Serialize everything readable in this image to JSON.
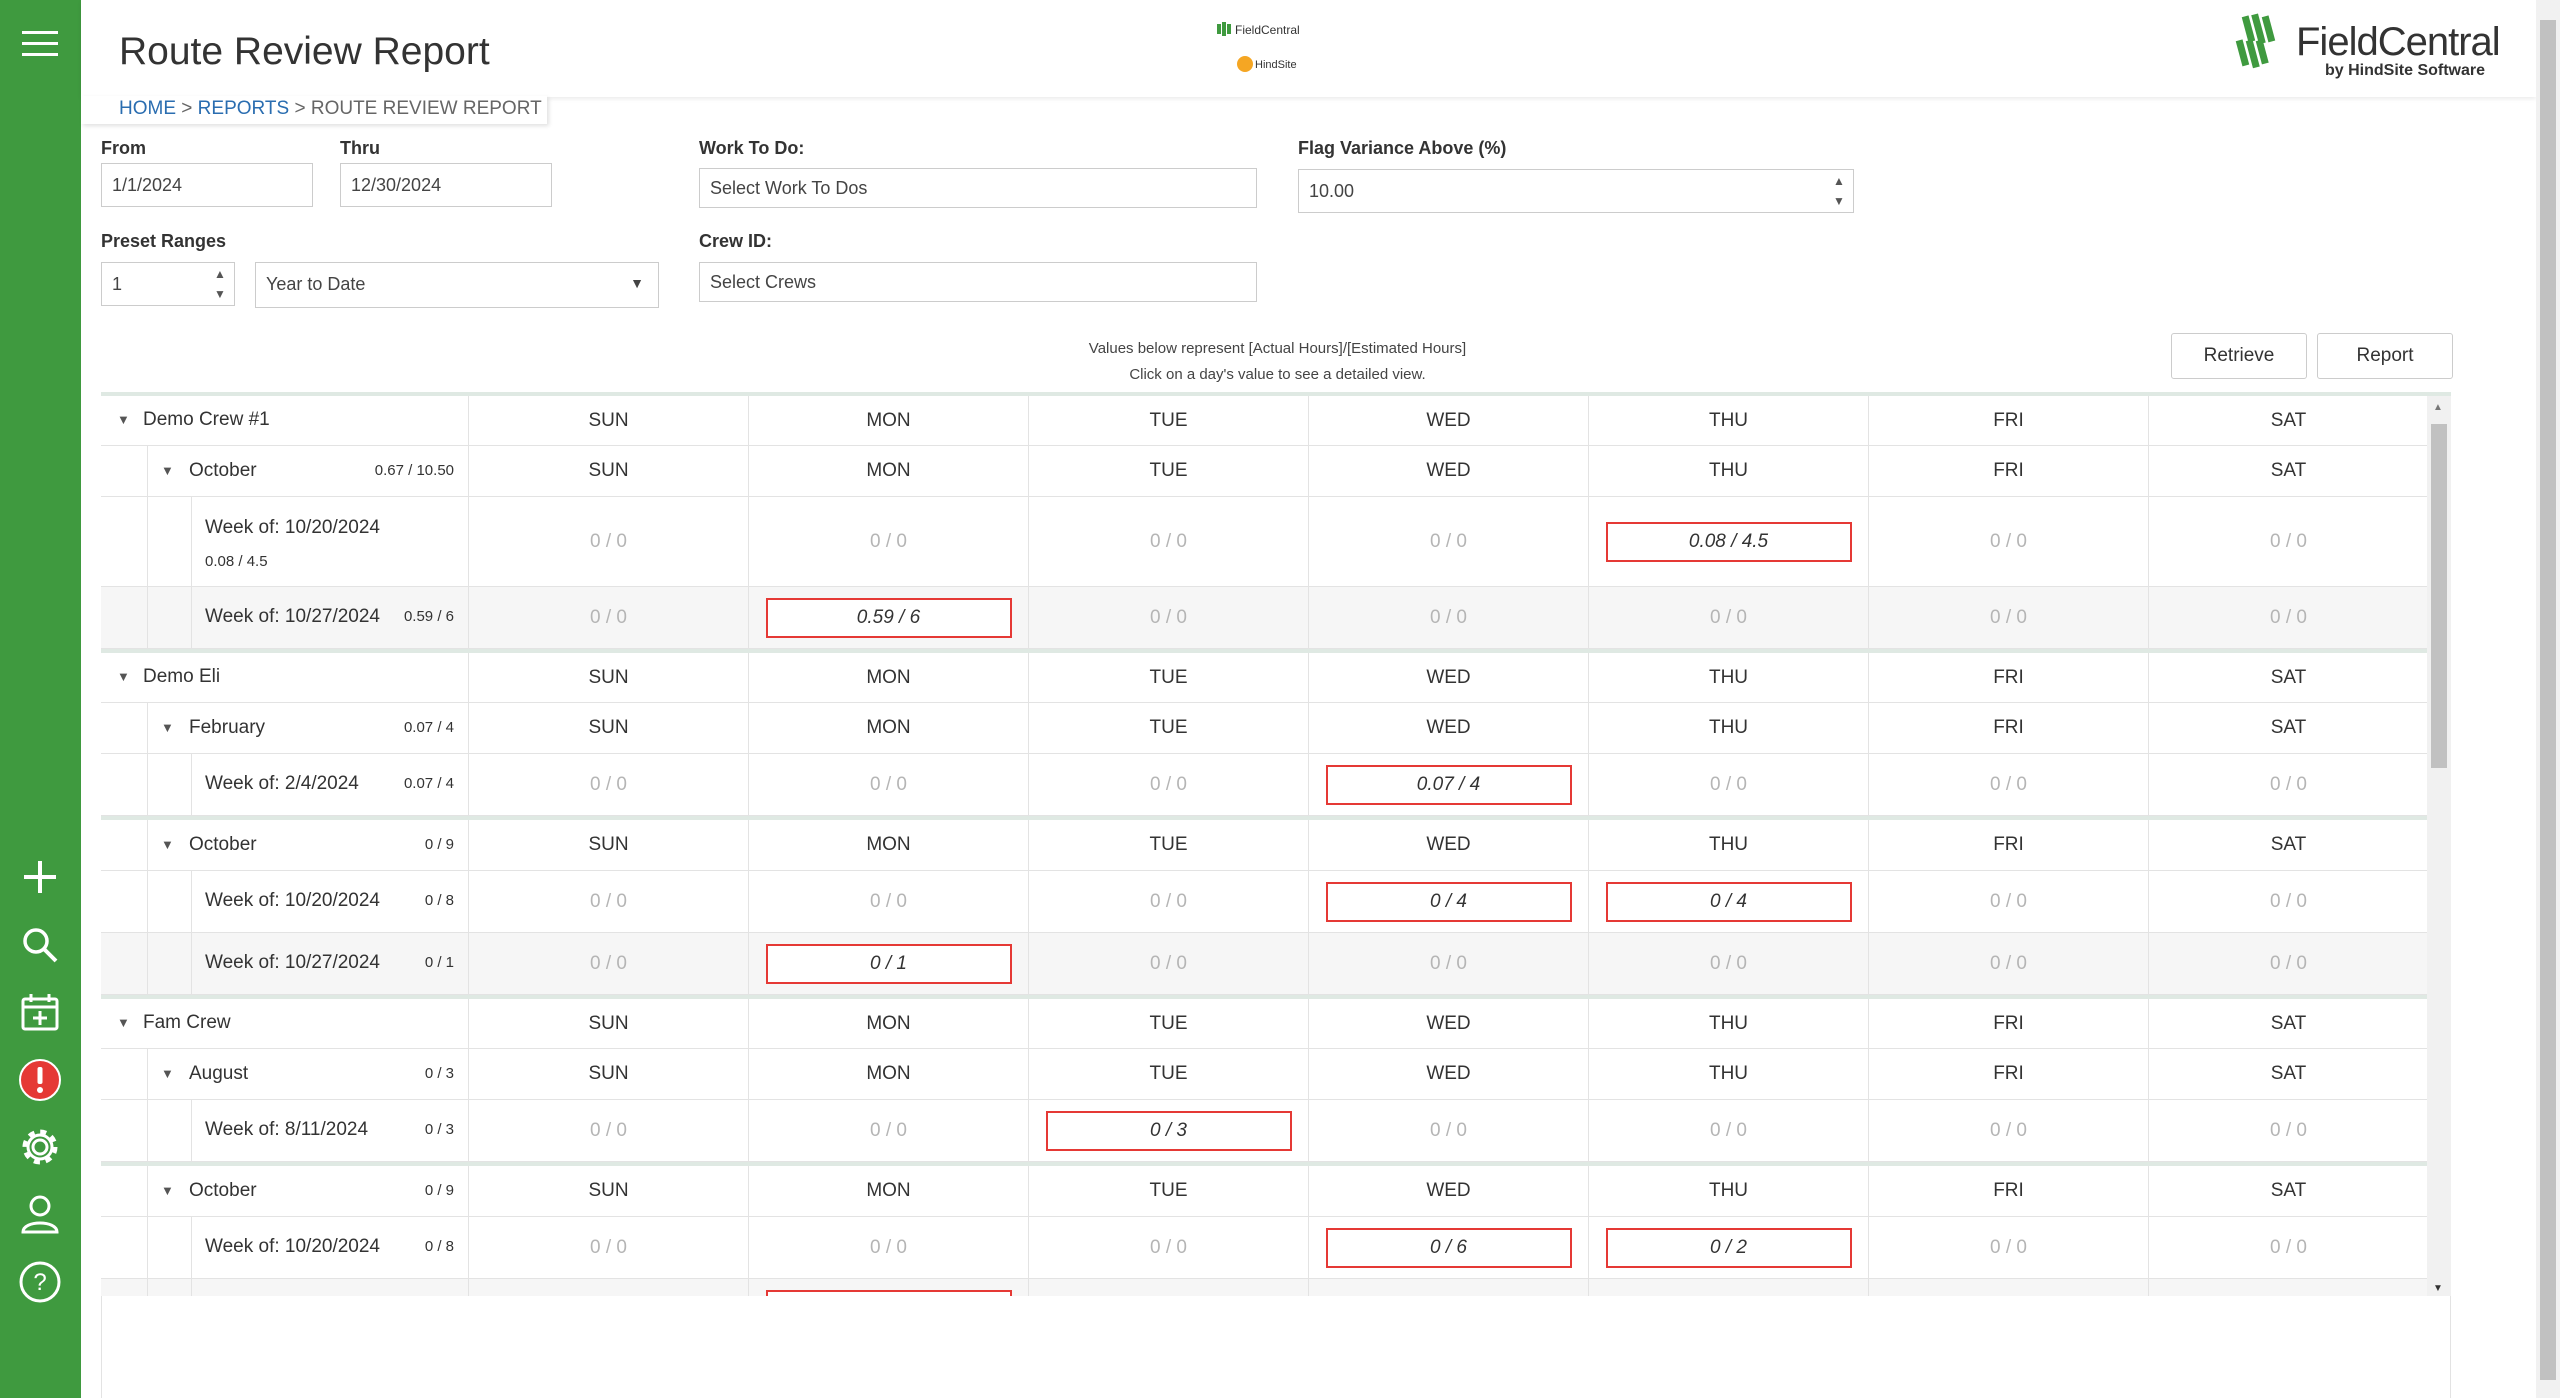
{
  "app": {
    "title": "Route Review Report",
    "brand_name": "FieldCentral",
    "brand_sub": "by HindSite Software",
    "center_logo_top": "FieldCentral",
    "center_logo_bottom": "HindSite",
    "accent_color": "#3f9a3f",
    "flag_color": "#e53935"
  },
  "breadcrumb": {
    "home": "HOME",
    "reports": "REPORTS",
    "current": "ROUTE REVIEW REPORT",
    "sep": ">"
  },
  "filters": {
    "from_label": "From",
    "from_value": "1/1/2024",
    "thru_label": "Thru",
    "thru_value": "12/30/2024",
    "work_label": "Work To Do:",
    "work_placeholder": "Select Work To Dos",
    "flag_label": "Flag Variance Above (%)",
    "flag_value": "10.00",
    "preset_label": "Preset Ranges",
    "preset_count": "1",
    "preset_range": "Year to Date",
    "crew_label": "Crew ID:",
    "crew_placeholder": "Select Crews"
  },
  "actions": {
    "retrieve": "Retrieve",
    "report": "Report"
  },
  "notes": {
    "line1": "Values below represent [Actual Hours]/[Estimated Hours]",
    "line2": "Click on a day's value to see a detailed view."
  },
  "days": [
    "SUN",
    "MON",
    "TUE",
    "WED",
    "THU",
    "FRI",
    "SAT"
  ],
  "sidebar": [
    "menu-icon",
    "add-icon",
    "search-icon",
    "calendar-add-icon",
    "alert-icon",
    "settings-icon",
    "user-icon",
    "help-icon"
  ],
  "rows": [
    {
      "kind": "crew",
      "label": "Demo Crew #1"
    },
    {
      "kind": "month",
      "label": "October",
      "sum": "0.67 / 10.50"
    },
    {
      "kind": "week",
      "label": "Week of: 10/20/2024",
      "sum": "0.08 / 4.5",
      "tall": true,
      "vals": [
        "0 / 0",
        "0 / 0",
        "0 / 0",
        "0 / 0",
        "0.08 / 4.5",
        "0 / 0",
        "0 / 0"
      ],
      "flags": [
        4
      ]
    },
    {
      "kind": "week",
      "label": "Week of: 10/27/2024",
      "sum": "0.59 / 6",
      "alt": true,
      "vals": [
        "0 / 0",
        "0.59 / 6",
        "0 / 0",
        "0 / 0",
        "0 / 0",
        "0 / 0",
        "0 / 0"
      ],
      "flags": [
        1
      ]
    },
    {
      "kind": "crew",
      "label": "Demo Eli",
      "sep": true
    },
    {
      "kind": "month",
      "label": "February",
      "sum": "0.07 / 4"
    },
    {
      "kind": "week",
      "label": "Week of: 2/4/2024",
      "sum": "0.07 / 4",
      "vals": [
        "0 / 0",
        "0 / 0",
        "0 / 0",
        "0.07 / 4",
        "0 / 0",
        "0 / 0",
        "0 / 0"
      ],
      "flags": [
        3
      ]
    },
    {
      "kind": "month",
      "label": "October",
      "sum": "0 / 9",
      "sep": true
    },
    {
      "kind": "week",
      "label": "Week of: 10/20/2024",
      "sum": "0 / 8",
      "vals": [
        "0 / 0",
        "0 / 0",
        "0 / 0",
        "0 / 4",
        "0 / 4",
        "0 / 0",
        "0 / 0"
      ],
      "flags": [
        3,
        4
      ]
    },
    {
      "kind": "week",
      "label": "Week of: 10/27/2024",
      "sum": "0 / 1",
      "alt": true,
      "vals": [
        "0 / 0",
        "0 / 1",
        "0 / 0",
        "0 / 0",
        "0 / 0",
        "0 / 0",
        "0 / 0"
      ],
      "flags": [
        1
      ]
    },
    {
      "kind": "crew",
      "label": "Fam Crew",
      "sep": true
    },
    {
      "kind": "month",
      "label": "August",
      "sum": "0 / 3"
    },
    {
      "kind": "week",
      "label": "Week of: 8/11/2024",
      "sum": "0 / 3",
      "vals": [
        "0 / 0",
        "0 / 0",
        "0 / 3",
        "0 / 0",
        "0 / 0",
        "0 / 0",
        "0 / 0"
      ],
      "flags": [
        2
      ]
    },
    {
      "kind": "month",
      "label": "October",
      "sum": "0 / 9",
      "sep": true
    },
    {
      "kind": "week",
      "label": "Week of: 10/20/2024",
      "sum": "0 / 8",
      "vals": [
        "0 / 0",
        "0 / 0",
        "0 / 0",
        "0 / 6",
        "0 / 2",
        "0 / 0",
        "0 / 0"
      ],
      "flags": [
        3,
        4
      ]
    },
    {
      "kind": "week",
      "label": "",
      "sum": "",
      "alt": true,
      "vals": [
        "",
        "",
        "",
        "",
        "",
        "",
        ""
      ],
      "flags": [
        1
      ]
    }
  ]
}
